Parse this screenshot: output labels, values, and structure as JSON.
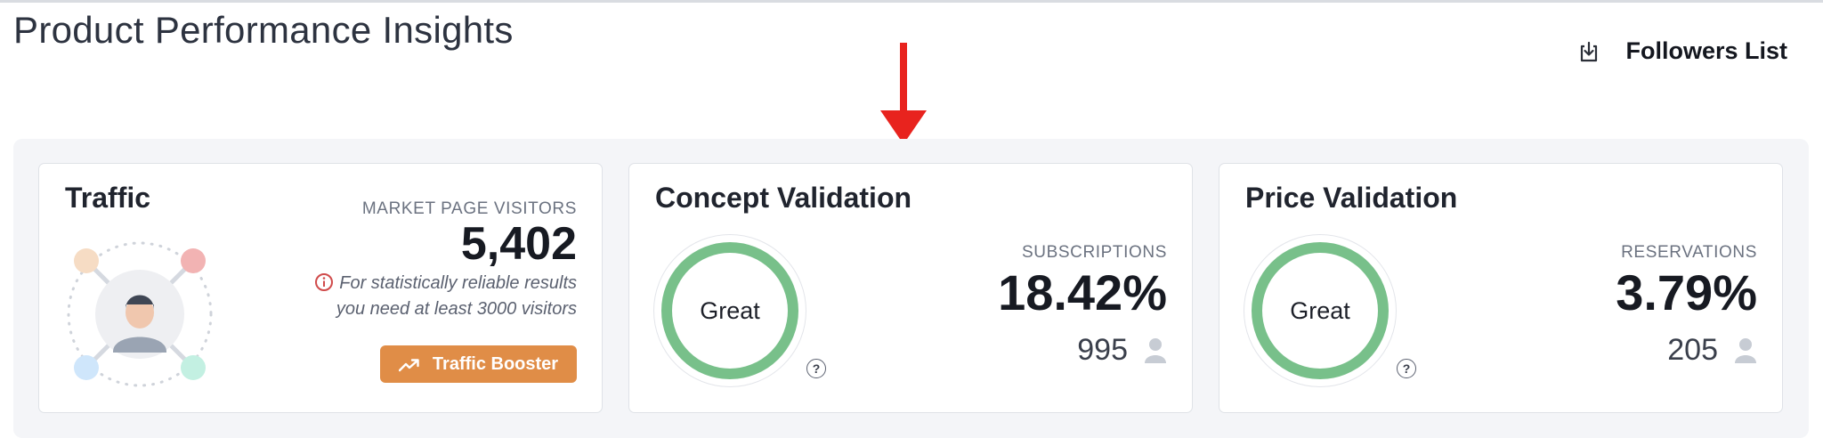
{
  "header": {
    "title": "Product Performance Insights",
    "followers_label": "Followers List"
  },
  "colors": {
    "ring": "#78c08a",
    "booster": "#e08d47",
    "arrow": "#e8231e",
    "panel_bg": "#f4f5f8"
  },
  "traffic": {
    "title": "Traffic",
    "metric_label": "MARKET PAGE VISITORS",
    "metric_value": "5,402",
    "note_line1": "For statistically reliable results",
    "note_line2": "you need at least 3000 visitors",
    "button_label": "Traffic Booster",
    "icons": [
      "avatar-network-illustration",
      "info-icon",
      "trend-up-icon"
    ]
  },
  "concept": {
    "title": "Concept Validation",
    "rating": "Great",
    "metric_label": "SUBSCRIPTIONS",
    "metric_value": "18.42%",
    "count": "995",
    "help": "?"
  },
  "price": {
    "title": "Price Validation",
    "rating": "Great",
    "metric_label": "RESERVATIONS",
    "metric_value": "3.79%",
    "count": "205",
    "help": "?"
  }
}
